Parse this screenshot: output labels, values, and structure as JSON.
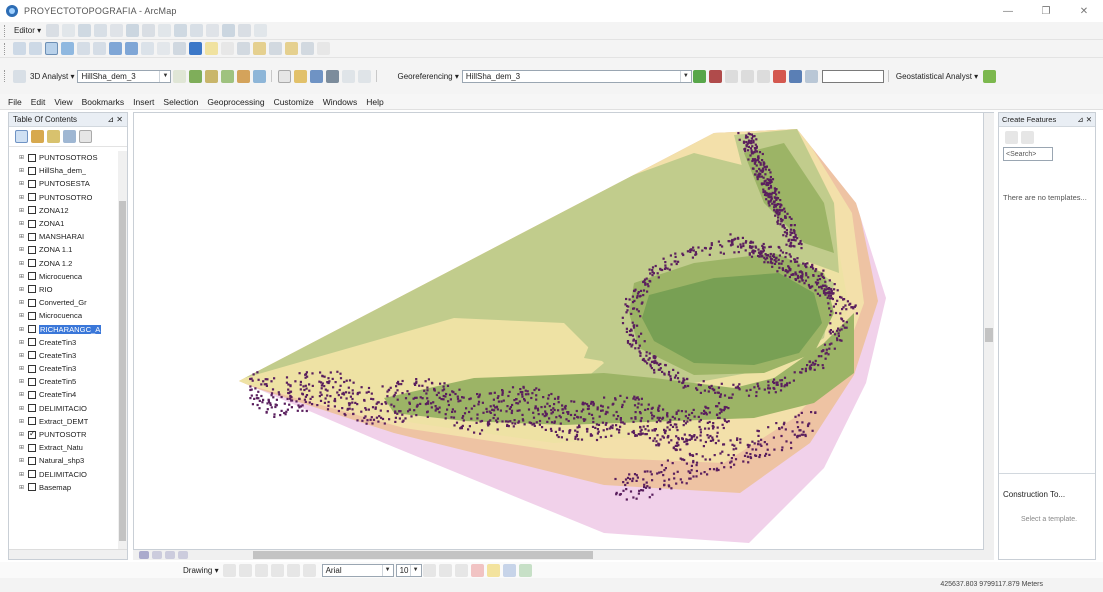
{
  "window": {
    "title": "PROYECTOTOPOGRAFIA - ArcMap",
    "minimize": "—",
    "restore": "❐",
    "close": "✕"
  },
  "toolbars": {
    "editor_label": "Editor ▾",
    "analyst_label": "3D Analyst ▾",
    "analyst_layer": "HillSha_dem_3",
    "georef_label": "Georeferencing ▾",
    "georef_layer": "HillSha_dem_3",
    "geostat_label": "Geostatistical Analyst ▾",
    "font_name": "Arial",
    "font_size": "10",
    "drawing_label": "Drawing ▾"
  },
  "menu": [
    "File",
    "Edit",
    "View",
    "Bookmarks",
    "Insert",
    "Selection",
    "Geoprocessing",
    "Customize",
    "Windows",
    "Help"
  ],
  "toc": {
    "title": "Table Of Contents",
    "pin": "⊿ ✕",
    "layers": [
      {
        "label": "PUNTOSOTROS",
        "checked": false
      },
      {
        "label": "HillSha_dem_",
        "checked": false
      },
      {
        "label": "PUNTOSESTA",
        "checked": false
      },
      {
        "label": "PUNTOSOTRO",
        "checked": false
      },
      {
        "label": "ZONA12",
        "checked": false
      },
      {
        "label": "ZONA1",
        "checked": false
      },
      {
        "label": "MANSHARAI",
        "checked": false
      },
      {
        "label": "ZONA 1.1",
        "checked": false
      },
      {
        "label": "ZONA 1.2",
        "checked": false
      },
      {
        "label": "Microcuenca",
        "checked": false
      },
      {
        "label": "RIO",
        "checked": false
      },
      {
        "label": "Converted_Gr",
        "checked": false
      },
      {
        "label": "Microcuenca",
        "checked": false
      },
      {
        "label": "RICHARANGC_A",
        "checked": false,
        "selected": true
      },
      {
        "label": "CreateTin3",
        "checked": false
      },
      {
        "label": "CreateTin3",
        "checked": false
      },
      {
        "label": "CreateTin3",
        "checked": false
      },
      {
        "label": "CreateTin5",
        "checked": false
      },
      {
        "label": "CreateTin4",
        "checked": false
      },
      {
        "label": "DELIMITACIO",
        "checked": false
      },
      {
        "label": "Extract_DEMT",
        "checked": false
      },
      {
        "label": "PUNTOSOTR",
        "checked": true
      },
      {
        "label": "Extract_Natu",
        "checked": false
      },
      {
        "label": "Natural_shp3",
        "checked": false
      },
      {
        "label": "DELIMITACIO",
        "checked": false
      },
      {
        "label": "Basemap",
        "checked": false
      }
    ]
  },
  "create_features": {
    "title": "Create Features",
    "controls": "⊿ ✕",
    "search_placeholder": "<Search>",
    "message": "There are no templates...",
    "construction_label": "Construction To...",
    "construction_note": "Select a template."
  },
  "status": {
    "coords": "425637.803  9799117.879 Meters"
  },
  "colors": {
    "zone_low": "#f1d1ea",
    "zone_mid1": "#eec3a3",
    "zone_mid2": "#f3e0aa",
    "zone_mid3": "#eee2a4",
    "zone_high1": "#c1cc8c",
    "zone_high2": "#9cb466",
    "zone_high3": "#78a054",
    "points": "#5a1f5e",
    "selection": "#3a77d9"
  }
}
